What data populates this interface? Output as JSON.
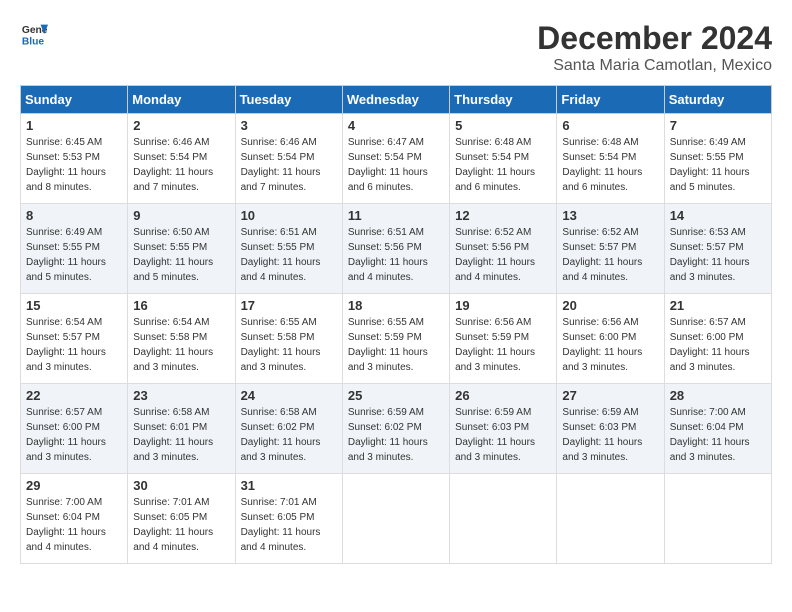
{
  "header": {
    "logo_line1": "General",
    "logo_line2": "Blue",
    "month": "December 2024",
    "location": "Santa Maria Camotlan, Mexico"
  },
  "weekdays": [
    "Sunday",
    "Monday",
    "Tuesday",
    "Wednesday",
    "Thursday",
    "Friday",
    "Saturday"
  ],
  "weeks": [
    [
      {
        "day": "1",
        "sunrise": "6:45 AM",
        "sunset": "5:53 PM",
        "daylight": "11 hours and 8 minutes."
      },
      {
        "day": "2",
        "sunrise": "6:46 AM",
        "sunset": "5:54 PM",
        "daylight": "11 hours and 7 minutes."
      },
      {
        "day": "3",
        "sunrise": "6:46 AM",
        "sunset": "5:54 PM",
        "daylight": "11 hours and 7 minutes."
      },
      {
        "day": "4",
        "sunrise": "6:47 AM",
        "sunset": "5:54 PM",
        "daylight": "11 hours and 6 minutes."
      },
      {
        "day": "5",
        "sunrise": "6:48 AM",
        "sunset": "5:54 PM",
        "daylight": "11 hours and 6 minutes."
      },
      {
        "day": "6",
        "sunrise": "6:48 AM",
        "sunset": "5:54 PM",
        "daylight": "11 hours and 6 minutes."
      },
      {
        "day": "7",
        "sunrise": "6:49 AM",
        "sunset": "5:55 PM",
        "daylight": "11 hours and 5 minutes."
      }
    ],
    [
      {
        "day": "8",
        "sunrise": "6:49 AM",
        "sunset": "5:55 PM",
        "daylight": "11 hours and 5 minutes."
      },
      {
        "day": "9",
        "sunrise": "6:50 AM",
        "sunset": "5:55 PM",
        "daylight": "11 hours and 5 minutes."
      },
      {
        "day": "10",
        "sunrise": "6:51 AM",
        "sunset": "5:55 PM",
        "daylight": "11 hours and 4 minutes."
      },
      {
        "day": "11",
        "sunrise": "6:51 AM",
        "sunset": "5:56 PM",
        "daylight": "11 hours and 4 minutes."
      },
      {
        "day": "12",
        "sunrise": "6:52 AM",
        "sunset": "5:56 PM",
        "daylight": "11 hours and 4 minutes."
      },
      {
        "day": "13",
        "sunrise": "6:52 AM",
        "sunset": "5:57 PM",
        "daylight": "11 hours and 4 minutes."
      },
      {
        "day": "14",
        "sunrise": "6:53 AM",
        "sunset": "5:57 PM",
        "daylight": "11 hours and 3 minutes."
      }
    ],
    [
      {
        "day": "15",
        "sunrise": "6:54 AM",
        "sunset": "5:57 PM",
        "daylight": "11 hours and 3 minutes."
      },
      {
        "day": "16",
        "sunrise": "6:54 AM",
        "sunset": "5:58 PM",
        "daylight": "11 hours and 3 minutes."
      },
      {
        "day": "17",
        "sunrise": "6:55 AM",
        "sunset": "5:58 PM",
        "daylight": "11 hours and 3 minutes."
      },
      {
        "day": "18",
        "sunrise": "6:55 AM",
        "sunset": "5:59 PM",
        "daylight": "11 hours and 3 minutes."
      },
      {
        "day": "19",
        "sunrise": "6:56 AM",
        "sunset": "5:59 PM",
        "daylight": "11 hours and 3 minutes."
      },
      {
        "day": "20",
        "sunrise": "6:56 AM",
        "sunset": "6:00 PM",
        "daylight": "11 hours and 3 minutes."
      },
      {
        "day": "21",
        "sunrise": "6:57 AM",
        "sunset": "6:00 PM",
        "daylight": "11 hours and 3 minutes."
      }
    ],
    [
      {
        "day": "22",
        "sunrise": "6:57 AM",
        "sunset": "6:00 PM",
        "daylight": "11 hours and 3 minutes."
      },
      {
        "day": "23",
        "sunrise": "6:58 AM",
        "sunset": "6:01 PM",
        "daylight": "11 hours and 3 minutes."
      },
      {
        "day": "24",
        "sunrise": "6:58 AM",
        "sunset": "6:02 PM",
        "daylight": "11 hours and 3 minutes."
      },
      {
        "day": "25",
        "sunrise": "6:59 AM",
        "sunset": "6:02 PM",
        "daylight": "11 hours and 3 minutes."
      },
      {
        "day": "26",
        "sunrise": "6:59 AM",
        "sunset": "6:03 PM",
        "daylight": "11 hours and 3 minutes."
      },
      {
        "day": "27",
        "sunrise": "6:59 AM",
        "sunset": "6:03 PM",
        "daylight": "11 hours and 3 minutes."
      },
      {
        "day": "28",
        "sunrise": "7:00 AM",
        "sunset": "6:04 PM",
        "daylight": "11 hours and 3 minutes."
      }
    ],
    [
      {
        "day": "29",
        "sunrise": "7:00 AM",
        "sunset": "6:04 PM",
        "daylight": "11 hours and 4 minutes."
      },
      {
        "day": "30",
        "sunrise": "7:01 AM",
        "sunset": "6:05 PM",
        "daylight": "11 hours and 4 minutes."
      },
      {
        "day": "31",
        "sunrise": "7:01 AM",
        "sunset": "6:05 PM",
        "daylight": "11 hours and 4 minutes."
      },
      null,
      null,
      null,
      null
    ]
  ]
}
